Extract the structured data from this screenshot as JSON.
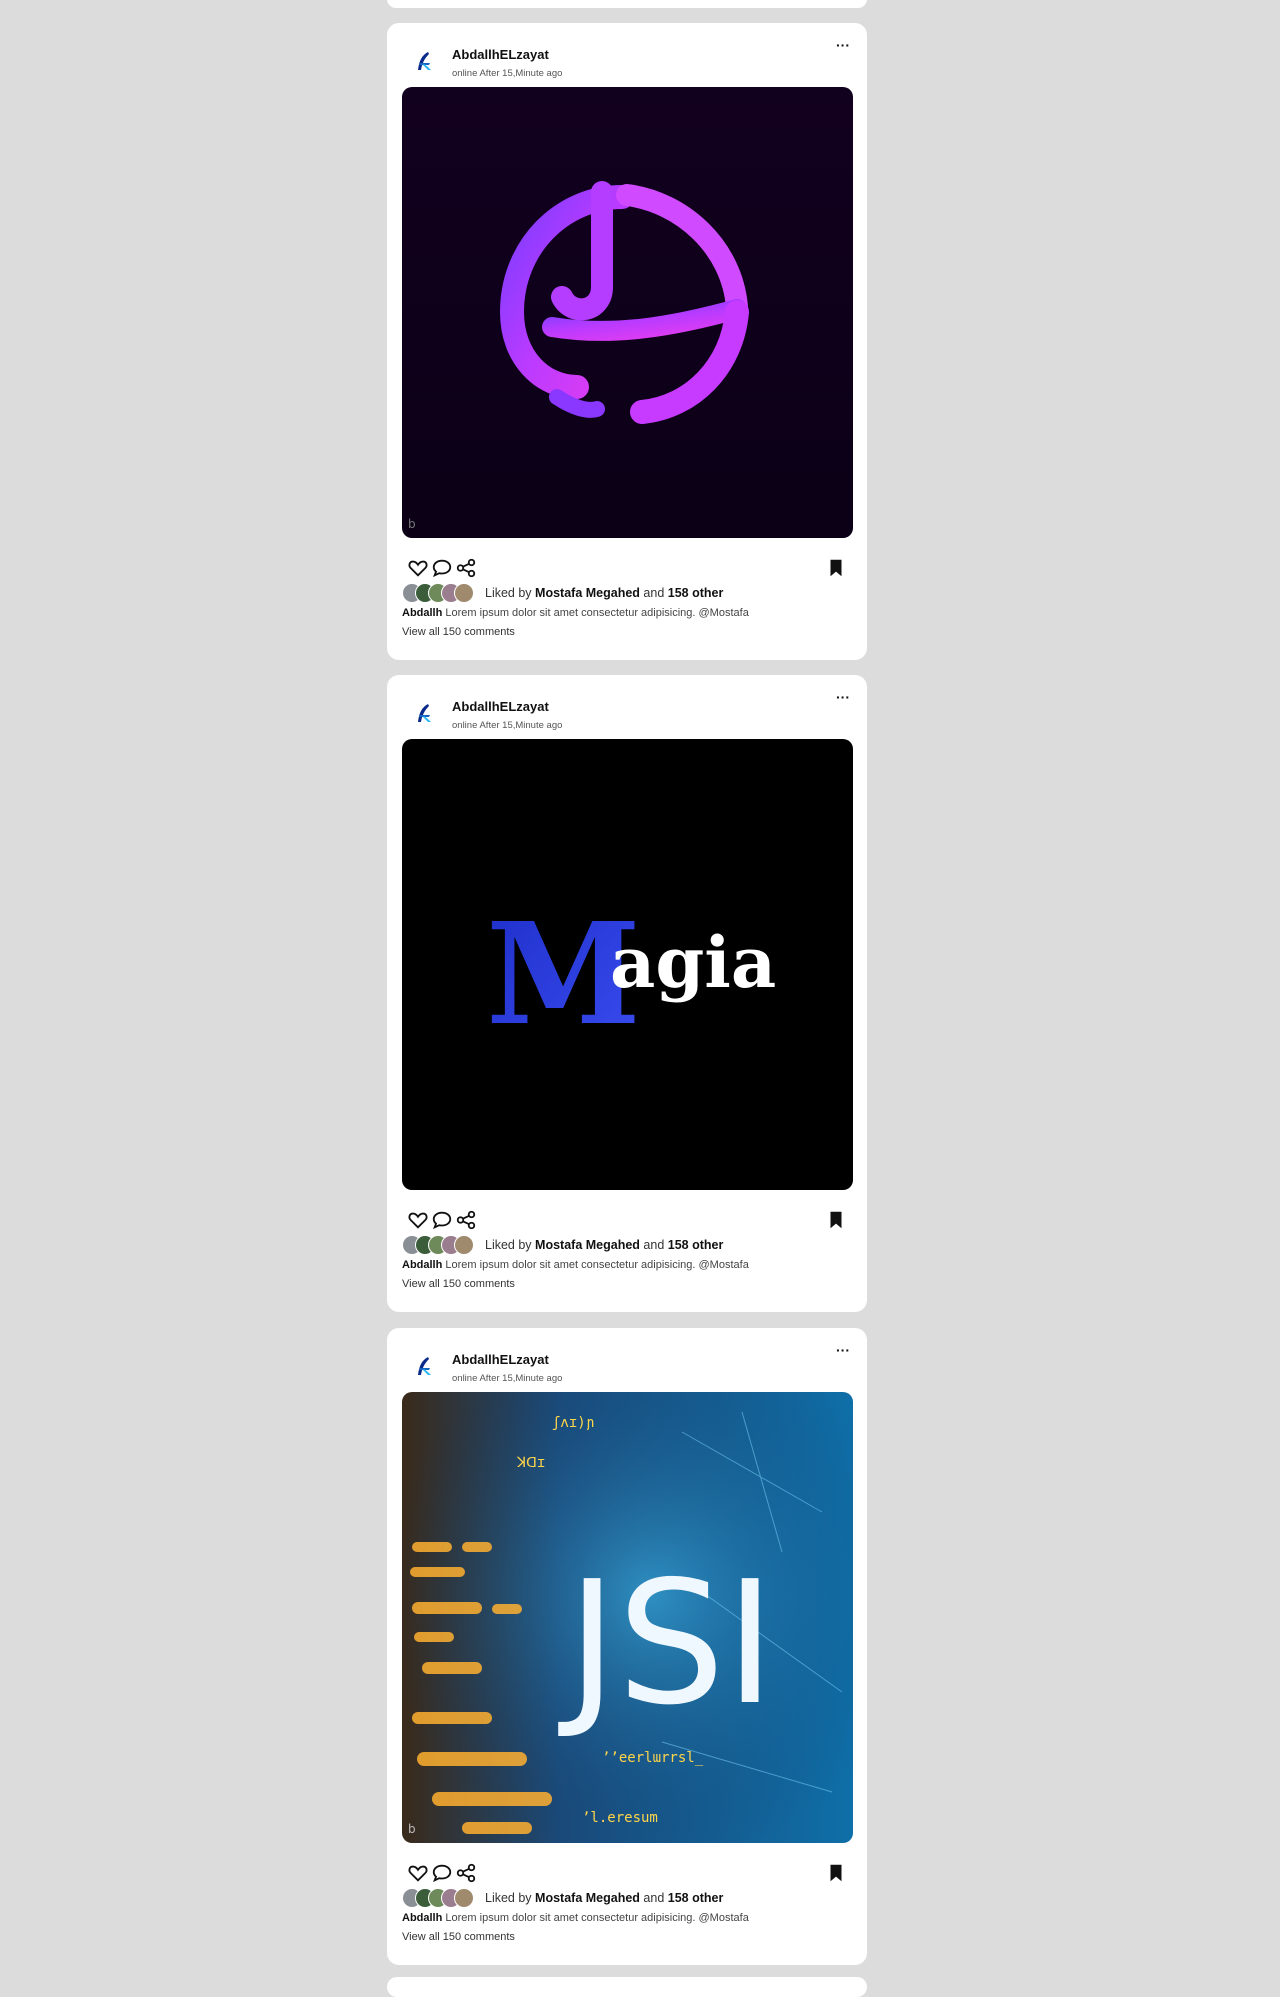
{
  "posts": [
    {
      "username": "AbdallhELzayat",
      "status": "online After 15,Minute ago",
      "more_label": "···",
      "image": "purple-music-logo",
      "liked_prefix": "Liked by",
      "liked_user": "Mostafa Megahed",
      "liked_and": "and",
      "liked_count": "158 other",
      "caption_user": "Abdallh",
      "caption_text": "Lorem ipsum dolor sit amet consectetur adipisicing. @Mostafa",
      "view_comments": "View all 150 comments"
    },
    {
      "username": "AbdallhELzayat",
      "status": "online After 15,Minute ago",
      "more_label": "···",
      "image": "magia-logo",
      "image_text_first": "M",
      "image_text_rest": "agia",
      "liked_prefix": "Liked by",
      "liked_user": "Mostafa Megahed",
      "liked_and": "and",
      "liked_count": "158 other",
      "caption_user": "Abdallh",
      "caption_text": "Lorem ipsum dolor sit amet consectetur adipisicing. @Mostafa",
      "view_comments": "View all 150 comments"
    },
    {
      "username": "AbdallhELzayat",
      "status": "online After 15,Minute ago",
      "more_label": "···",
      "image": "js-code-art",
      "image_text": "JSI",
      "liked_prefix": "Liked by",
      "liked_user": "Mostafa Megahed",
      "liked_and": "and",
      "liked_count": "158 other",
      "caption_user": "Abdallh",
      "caption_text": "Lorem ipsum dolor sit amet consectetur adipisicing. @Mostafa",
      "view_comments": "View all 150 comments"
    }
  ],
  "colors": {
    "background": "#dcdcdc",
    "card": "#ffffff",
    "purple": "#b23cff",
    "magia_blue": "#2a35d8"
  },
  "icons": [
    "avatar-logo-icon",
    "more-icon",
    "heart-icon",
    "comment-icon",
    "share-icon",
    "bookmark-icon"
  ]
}
